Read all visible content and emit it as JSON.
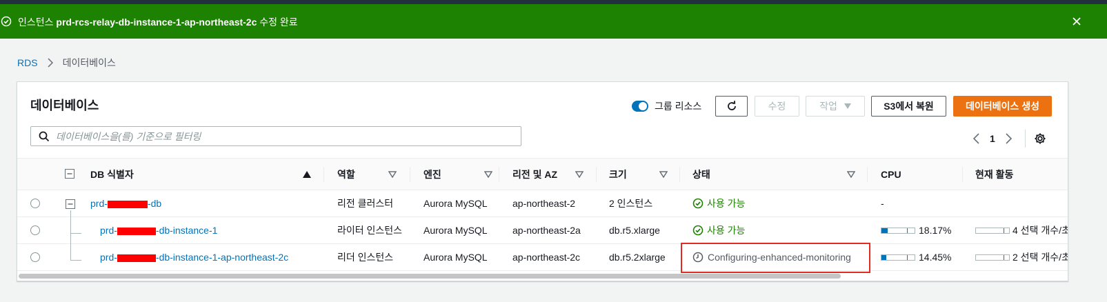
{
  "flash": {
    "prefix": "인스턴스 ",
    "instance": "prd-rcs-relay-db-instance-1-ap-northeast-2c",
    "suffix": " 수정 완료"
  },
  "breadcrumb": {
    "root": "RDS",
    "current": "데이터베이스"
  },
  "panel": {
    "title": "데이터베이스",
    "group_toggle_label": "그룹 리소스",
    "group_toggle_on": true,
    "buttons": {
      "modify": "수정",
      "actions": "작업",
      "restore_s3": "S3에서 복원",
      "create": "데이터베이스 생성"
    },
    "filter_placeholder": "데이터베이스을(를) 기준으로 필터링",
    "page": "1"
  },
  "columns": {
    "identifier": "DB 식별자",
    "role": "역할",
    "engine": "엔진",
    "region": "리전 및 AZ",
    "size": "크기",
    "status": "상태",
    "cpu": "CPU",
    "activity": "현재 활동"
  },
  "rows": [
    {
      "id_prefix": "prd-",
      "id_suffix": "-db",
      "role": "리전 클러스터",
      "engine": "Aurora MySQL",
      "region": "ap-northeast-2",
      "size": "2 인스턴스",
      "status": "사용 가능",
      "cpu": "-",
      "activity": ""
    },
    {
      "id_prefix": "prd-",
      "id_suffix": "-db-instance-1",
      "role": "라이터 인스턴스",
      "engine": "Aurora MySQL",
      "region": "ap-northeast-2a",
      "size": "db.r5.xlarge",
      "status": "사용 가능",
      "cpu": "18.17%",
      "cpu_value": 18.17,
      "activity": "4 선택 개수/초"
    },
    {
      "id_prefix": "prd-",
      "id_suffix": "-db-instance-1-ap-northeast-2c",
      "role": "리더 인스턴스",
      "engine": "Aurora MySQL",
      "region": "ap-northeast-2c",
      "size": "db.r5.2xlarge",
      "status": "Configuring-enhanced-monitoring",
      "cpu": "14.45%",
      "cpu_value": 14.45,
      "activity": "2 선택 개수/초"
    }
  ],
  "colors": {
    "success": "#1d8102",
    "link": "#0073bb",
    "primary": "#ec7211",
    "highlight": "#e22b1e"
  }
}
